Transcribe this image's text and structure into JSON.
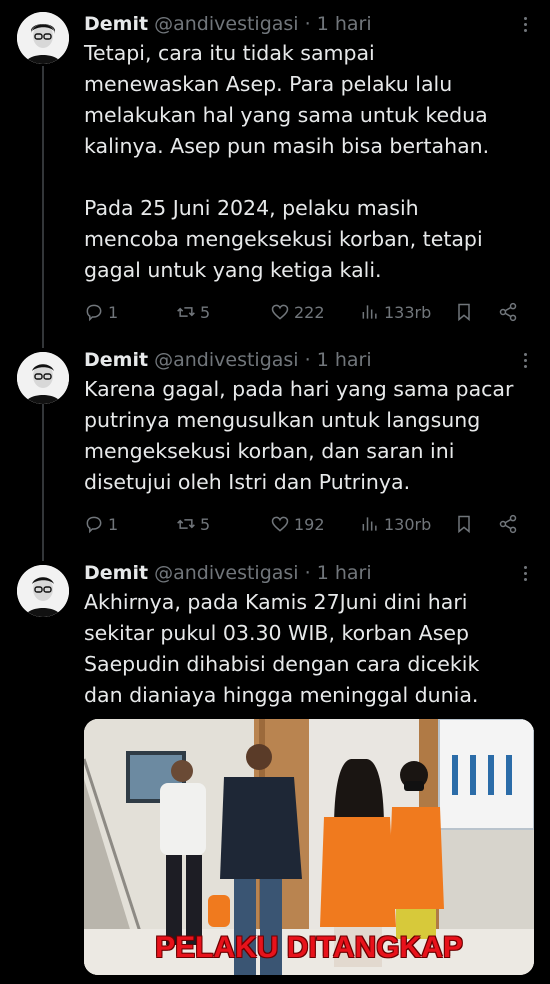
{
  "author": {
    "name": "Demit",
    "handle": "@andivestigasi",
    "time": "· 1 hari"
  },
  "tweets": [
    {
      "text": "Tetapi, cara itu tidak sampai\nmenewaskan Asep. Para pelaku lalu\nmelakukan hal yang sama untuk kedua\nkalinya. Asep pun masih bisa bertahan.\n\nPada 25 Juni 2024, pelaku masih\nmencoba mengeksekusi korban, tetapi\ngagal untuk yang ketiga kali.",
      "replies": "1",
      "retweets": "5",
      "likes": "222",
      "views": "133rb"
    },
    {
      "text": "Karena gagal, pada hari yang sama pacar\nputrinya mengusulkan untuk langsung\nmengeksekusi korban, dan saran ini\ndisetujui oleh Istri dan Putrinya.",
      "replies": "1",
      "retweets": "5",
      "likes": "192",
      "views": "130rb"
    },
    {
      "text": "Akhirnya, pada Kamis 27Juni dini hari\nsekitar pukul 03.30 WIB, korban Asep\nSaepudin dihabisi dengan cara dicekik\ndan dianiaya hingga meninggal dunia.",
      "media_caption": "PELAKU DITANGKAP"
    }
  ],
  "icons": [
    "reply-icon",
    "retweet-icon",
    "like-icon",
    "views-icon",
    "bookmark-icon",
    "share-icon",
    "more-icon"
  ],
  "colors": {
    "background": "#000000",
    "text": "#e7e9ea",
    "muted": "#71767b",
    "caption": "#e8121b",
    "jumpsuit": "#f07a1e"
  }
}
